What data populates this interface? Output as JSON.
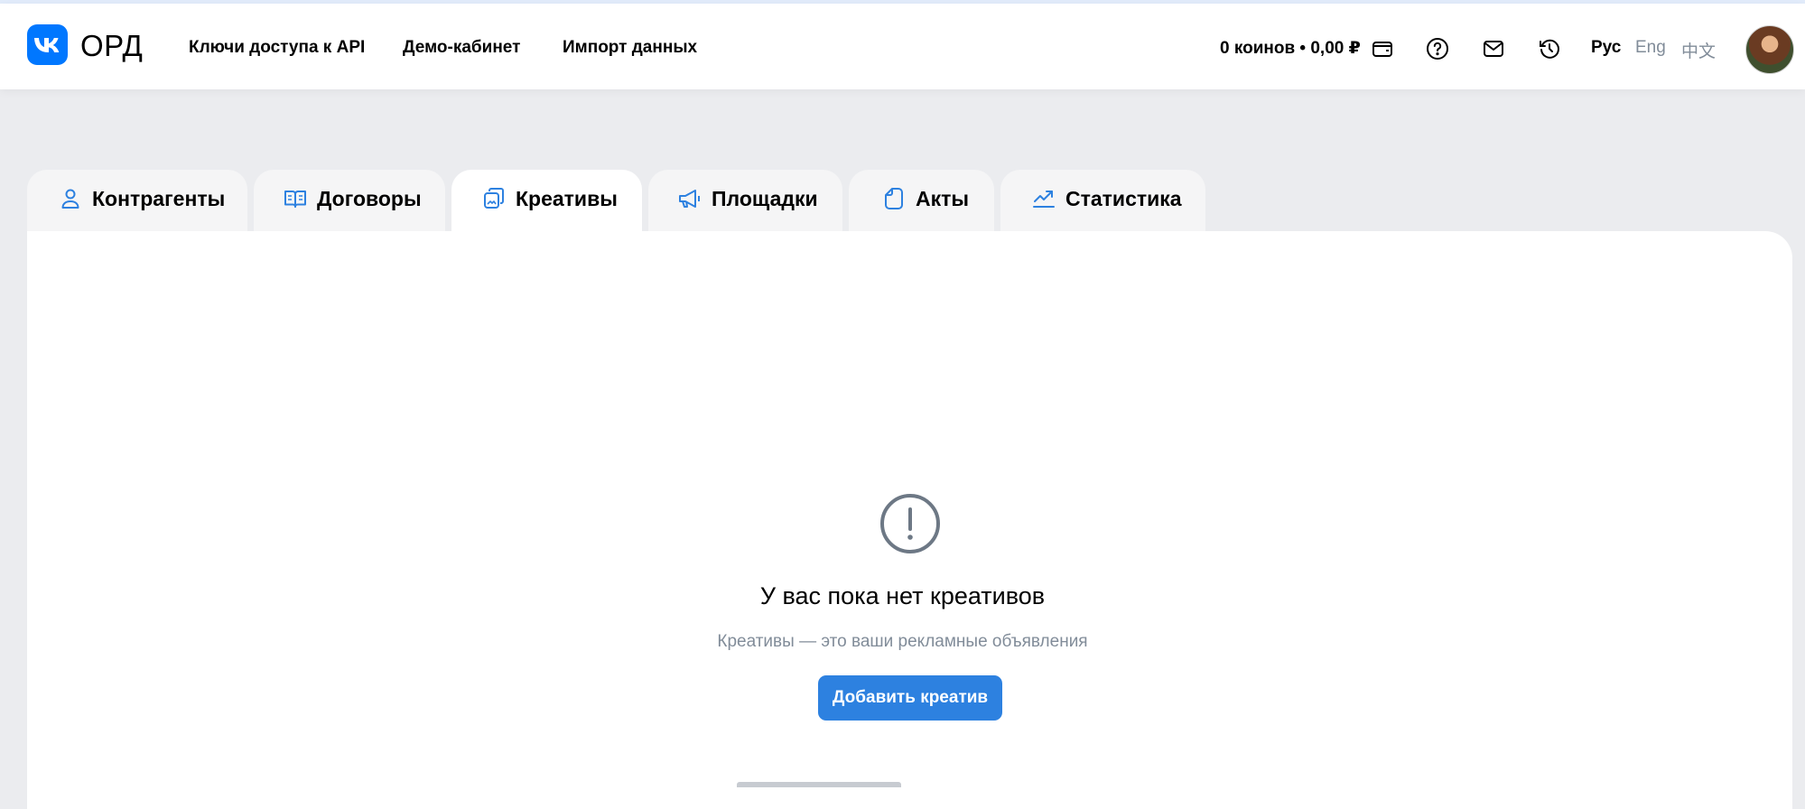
{
  "header": {
    "logo_text": "ОРД",
    "nav": [
      {
        "label": "Ключи доступа к API"
      },
      {
        "label": "Демо-кабинет"
      },
      {
        "label": "Импорт данных"
      }
    ],
    "balance": "0 коинов • 0,00 ₽",
    "languages": [
      {
        "label": "Рус",
        "active": true
      },
      {
        "label": "Eng",
        "active": false
      },
      {
        "label": "中文",
        "active": false
      }
    ]
  },
  "tabs": [
    {
      "label": "Контрагенты",
      "icon": "user-icon"
    },
    {
      "label": "Договоры",
      "icon": "book-icon"
    },
    {
      "label": "Креативы",
      "icon": "creatives-icon",
      "active": true
    },
    {
      "label": "Площадки",
      "icon": "megaphone-icon"
    },
    {
      "label": "Акты",
      "icon": "document-icon"
    },
    {
      "label": "Статистика",
      "icon": "chart-icon"
    }
  ],
  "empty_state": {
    "icon": "exclamation-circle-icon",
    "title": "У вас пока нет креативов",
    "subtitle": "Креативы — это ваши рекламные объявления",
    "button_label": "Добавить креатив"
  },
  "colors": {
    "accent": "#2d81e0",
    "logo_blue": "#0077ff",
    "background": "#ebecef",
    "muted_text": "#818c99"
  }
}
